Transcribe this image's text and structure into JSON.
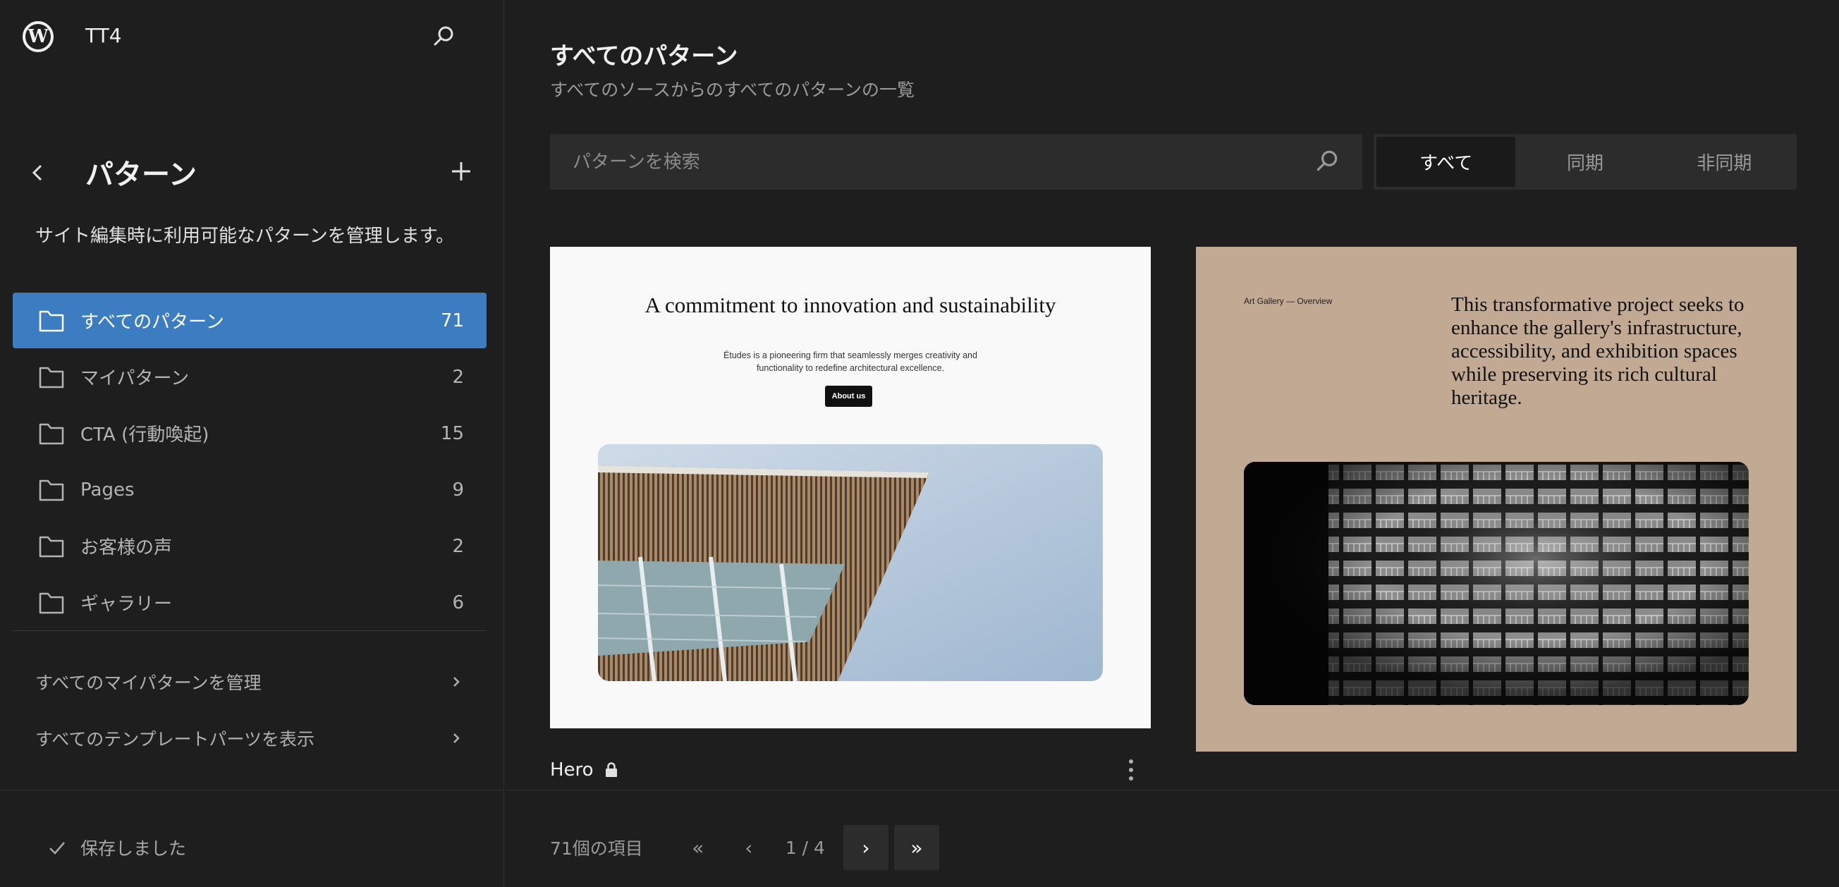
{
  "site": {
    "title": "TT4"
  },
  "sidebar": {
    "title": "パターン",
    "description": "サイト編集時に利用可能なパターンを管理します。",
    "categories": [
      {
        "label": "すべてのパターン",
        "count": "71",
        "active": true
      },
      {
        "label": "マイパターン",
        "count": "2"
      },
      {
        "label": "CTA (行動喚起)",
        "count": "15"
      },
      {
        "label": "Pages",
        "count": "9"
      },
      {
        "label": "お客様の声",
        "count": "2"
      },
      {
        "label": "ギャラリー",
        "count": "6"
      }
    ],
    "links": [
      {
        "label": "すべてのマイパターンを管理"
      },
      {
        "label": "すべてのテンプレートパーツを表示"
      }
    ],
    "saved_label": "保存しました"
  },
  "main": {
    "title": "すべてのパターン",
    "description": "すべてのソースからのすべてのパターンの一覧",
    "search": {
      "placeholder": "パターンを検索",
      "value": ""
    },
    "filters": [
      {
        "label": "すべて",
        "active": true
      },
      {
        "label": "同期"
      },
      {
        "label": "非同期"
      }
    ],
    "cards": [
      {
        "name": "Hero",
        "locked": true,
        "preview": {
          "heading": "A commitment to innovation and sustainability",
          "text": "Études is a pioneering firm that seamlessly merges creativity and functionality to redefine architectural excellence.",
          "button": "About us"
        }
      },
      {
        "preview": {
          "label": "Art Gallery — Overview",
          "text": "This transformative project seeks to enhance the gallery's infrastructure, accessibility, and exhibition spaces while preserving its rich cultural heritage."
        }
      }
    ],
    "pagination": {
      "total_label": "71個の項目",
      "first": "«",
      "prev": "‹",
      "page_info": "1 / 4",
      "next": "›",
      "last": "»"
    }
  },
  "colors": {
    "accent": "#3b7dc0",
    "background": "#1e1e1e",
    "card2_bg": "#c1a993"
  }
}
